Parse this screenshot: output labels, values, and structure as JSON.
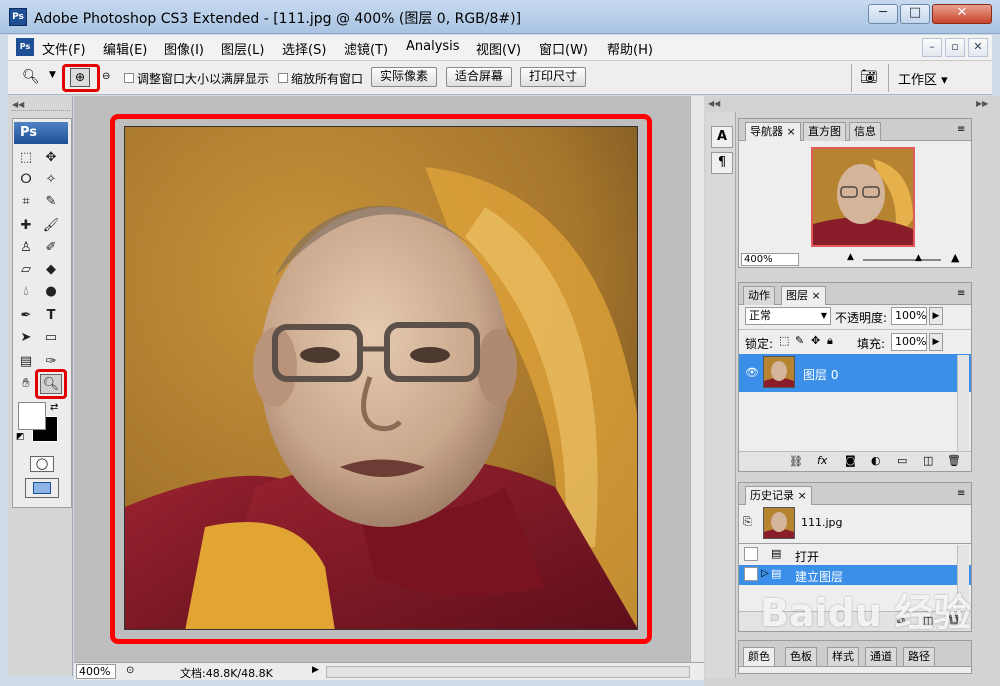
{
  "window": {
    "title": "Adobe Photoshop CS3 Extended - [111.jpg @ 400% (图层 0, RGB/8#)]",
    "app_icon_text": "Ps",
    "minimize": "─",
    "maximize": "□",
    "close": "✕"
  },
  "menubar": {
    "items": [
      "文件(F)",
      "编辑(E)",
      "图像(I)",
      "图层(L)",
      "选择(S)",
      "滤镜(T)",
      "Analysis",
      "视图(V)",
      "窗口(W)",
      "帮助(H)"
    ],
    "doc_minimize": "–",
    "doc_restore": "▫",
    "doc_close": "✕"
  },
  "options": {
    "resize_windows": "调整窗口大小以满屏显示",
    "zoom_all_windows": "缩放所有窗口",
    "actual_pixels": "实际像素",
    "fit_screen": "适合屏幕",
    "print_size": "打印尺寸",
    "workspace": "工作区 ▾"
  },
  "toolbox": {
    "logo": "Ps"
  },
  "status": {
    "zoom": "400%",
    "doc_info": "文档:48.8K/48.8K"
  },
  "navigator": {
    "tabs": [
      "导航器",
      "直方图",
      "信息"
    ],
    "zoom": "400%"
  },
  "layers": {
    "tabs": [
      "动作",
      "图层"
    ],
    "blend_mode": "正常",
    "opacity_label": "不透明度:",
    "opacity_value": "100%",
    "lock_label": "锁定:",
    "fill_label": "填充:",
    "fill_value": "100%",
    "layer_name": "图层 0"
  },
  "history": {
    "tab": "历史记录",
    "snapshot": "111.jpg",
    "steps": [
      "打开",
      "建立图层"
    ]
  },
  "bottom_panel": {
    "tabs": [
      "颜色",
      "色板",
      "样式",
      "通道",
      "路径"
    ]
  },
  "watermark": "Baidu 经验",
  "colors": {
    "selection": "#3b8fe8",
    "highlight_frame": "#ff0000"
  }
}
